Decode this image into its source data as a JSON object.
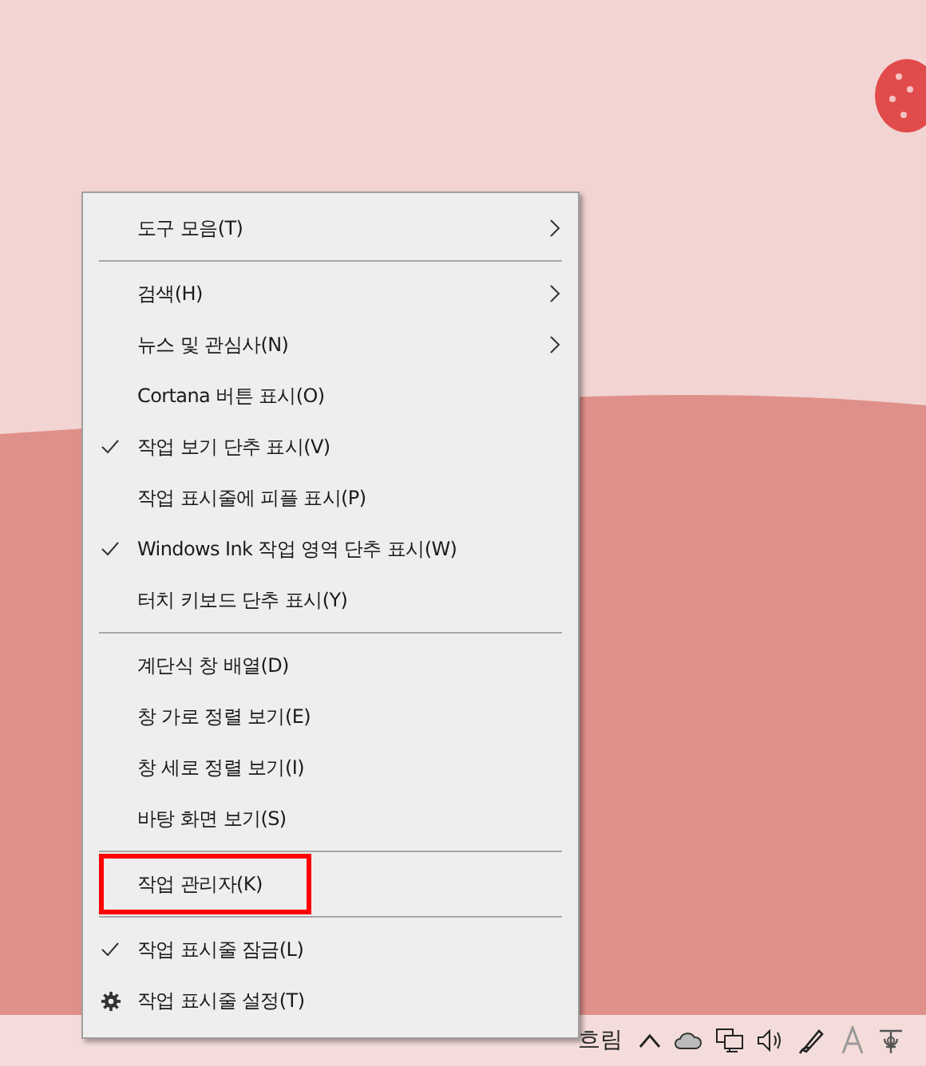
{
  "context_menu": {
    "items": [
      {
        "kind": "item",
        "label": "도구 모음(T)",
        "checked": false,
        "submenu": true,
        "highlighted": false
      },
      {
        "kind": "separator"
      },
      {
        "kind": "item",
        "label": "검색(H)",
        "checked": false,
        "submenu": true,
        "highlighted": false
      },
      {
        "kind": "item",
        "label": "뉴스 및 관심사(N)",
        "checked": false,
        "submenu": true,
        "highlighted": false
      },
      {
        "kind": "item",
        "label": "Cortana 버튼 표시(O)",
        "checked": false,
        "submenu": false,
        "highlighted": false
      },
      {
        "kind": "item",
        "label": "작업 보기 단추 표시(V)",
        "checked": true,
        "submenu": false,
        "highlighted": false
      },
      {
        "kind": "item",
        "label": "작업 표시줄에 피플 표시(P)",
        "checked": false,
        "submenu": false,
        "highlighted": false
      },
      {
        "kind": "item",
        "label": "Windows Ink 작업 영역 단추 표시(W)",
        "checked": true,
        "submenu": false,
        "highlighted": false
      },
      {
        "kind": "item",
        "label": "터치 키보드 단추 표시(Y)",
        "checked": false,
        "submenu": false,
        "highlighted": false
      },
      {
        "kind": "separator"
      },
      {
        "kind": "item",
        "label": "계단식 창 배열(D)",
        "checked": false,
        "submenu": false,
        "highlighted": false
      },
      {
        "kind": "item",
        "label": "창 가로 정렬 보기(E)",
        "checked": false,
        "submenu": false,
        "highlighted": false
      },
      {
        "kind": "item",
        "label": "창 세로 정렬 보기(I)",
        "checked": false,
        "submenu": false,
        "highlighted": false
      },
      {
        "kind": "item",
        "label": "바탕 화면 보기(S)",
        "checked": false,
        "submenu": false,
        "highlighted": false
      },
      {
        "kind": "separator"
      },
      {
        "kind": "item",
        "label": "작업 관리자(K)",
        "checked": false,
        "submenu": false,
        "highlighted": true
      },
      {
        "kind": "separator"
      },
      {
        "kind": "item",
        "label": "작업 표시줄 잠금(L)",
        "checked": true,
        "submenu": false,
        "highlighted": false
      },
      {
        "kind": "settings",
        "label": "작업 표시줄 설정(T)",
        "submenu": false,
        "highlighted": false
      }
    ]
  },
  "taskbar": {
    "weather": "흐림"
  }
}
